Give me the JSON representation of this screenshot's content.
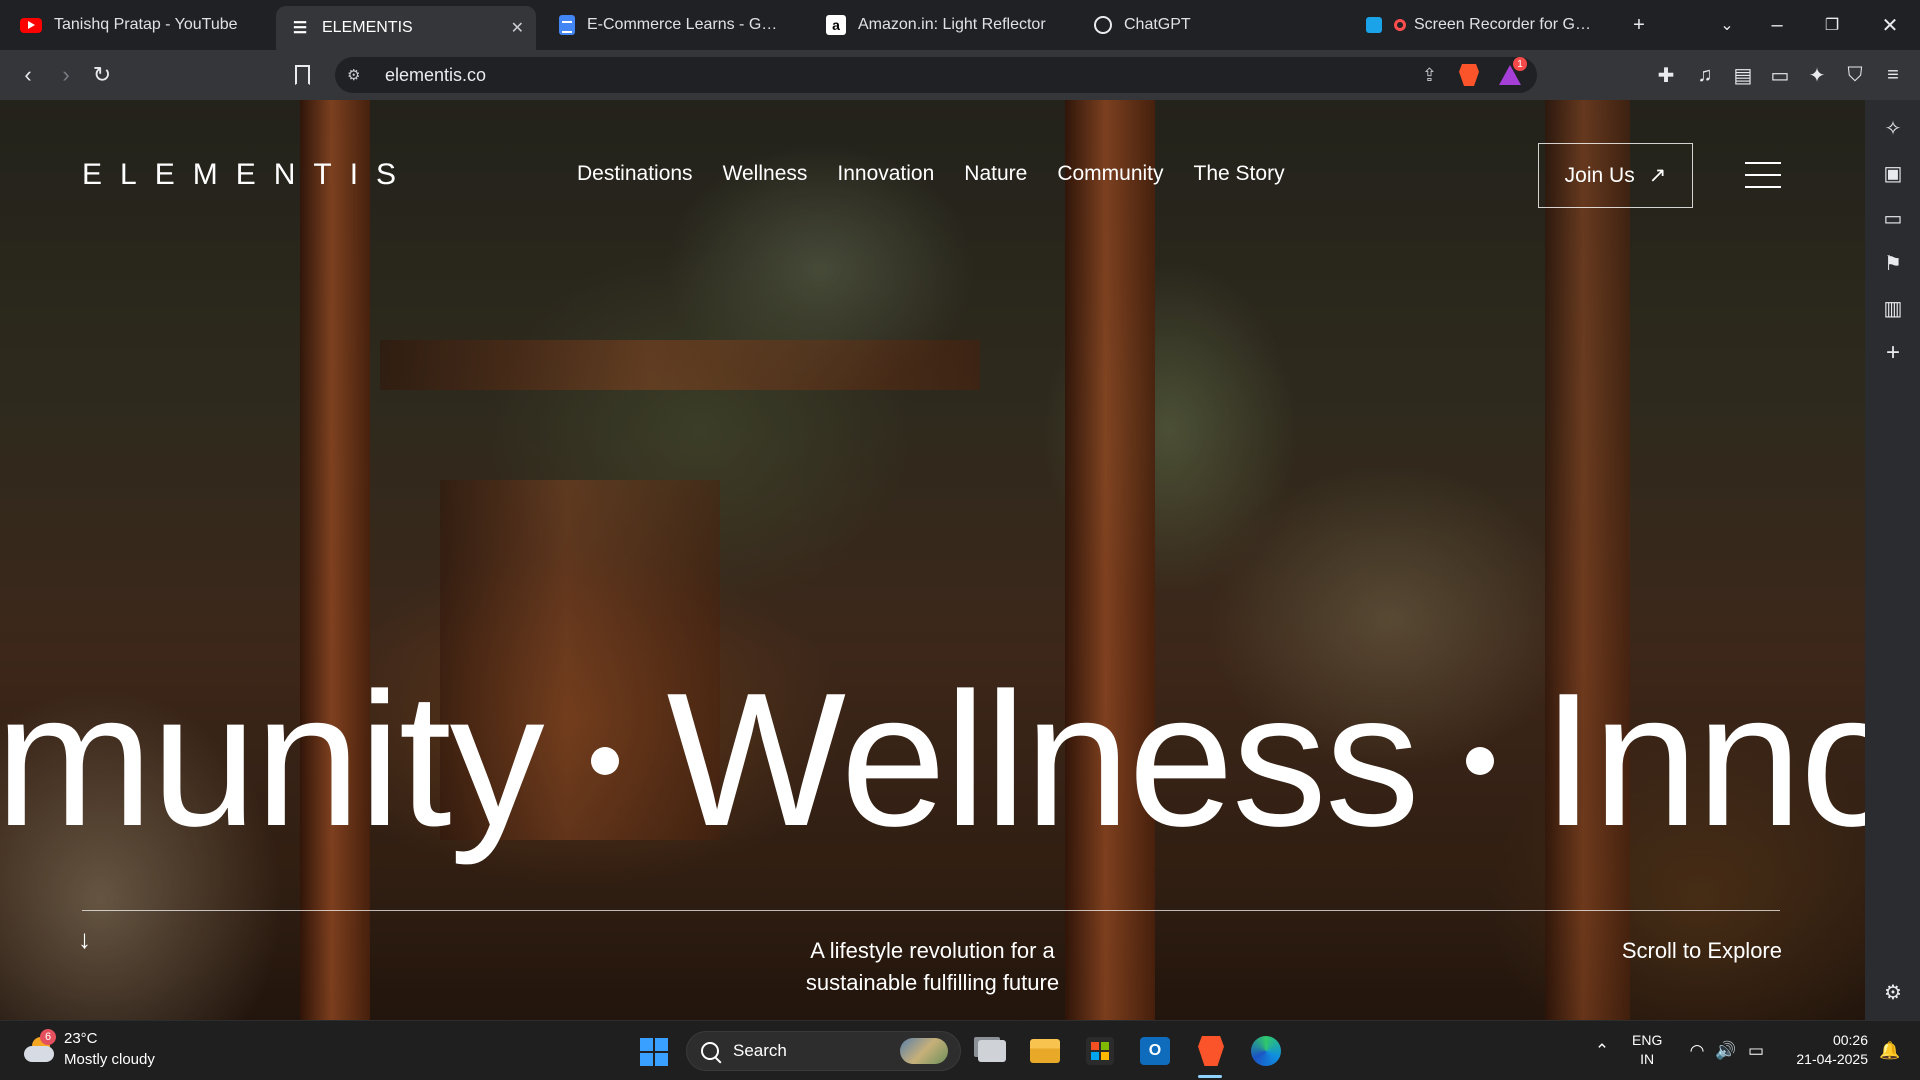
{
  "browser": {
    "tabs": [
      {
        "title": "Tanishq Pratap - YouTube",
        "icon": "youtube-icon"
      },
      {
        "title": "ELEMENTIS",
        "icon": "elementis-icon",
        "active": true
      },
      {
        "title": "E-Commerce Learns - Google D",
        "icon": "google-docs-icon"
      },
      {
        "title": "Amazon.in: Light Reflector",
        "icon": "amazon-icon"
      },
      {
        "title": "ChatGPT",
        "icon": "chatgpt-icon"
      },
      {
        "title": "Screen Recorder for Google",
        "icon": "screen-recorder-icon"
      }
    ],
    "url": "elementis.co",
    "rewards_badge": "1"
  },
  "site": {
    "logo": "ELEMENTIS",
    "nav": [
      "Destinations",
      "Wellness",
      "Innovation",
      "Nature",
      "Community",
      "The Story"
    ],
    "join_label": "Join Us",
    "join_arrow": "↗",
    "marquee": [
      "munity",
      "Wellness",
      "Innov"
    ],
    "tagline_line1": "A lifestyle revolution for a",
    "tagline_line2": "sustainable fulfilling future",
    "scroll_hint": "Scroll to Explore",
    "down_arrow": "↓"
  },
  "taskbar": {
    "weather_badge": "6",
    "temperature": "23°C",
    "condition": "Mostly cloudy",
    "search_placeholder": "Search",
    "lang_line1": "ENG",
    "lang_line2": "IN",
    "time": "00:26",
    "date": "21-04-2025"
  },
  "colors": {
    "accent_active_app": "#8fd3ff",
    "brave": "#fb542b",
    "rewards": "#a63fd8"
  }
}
